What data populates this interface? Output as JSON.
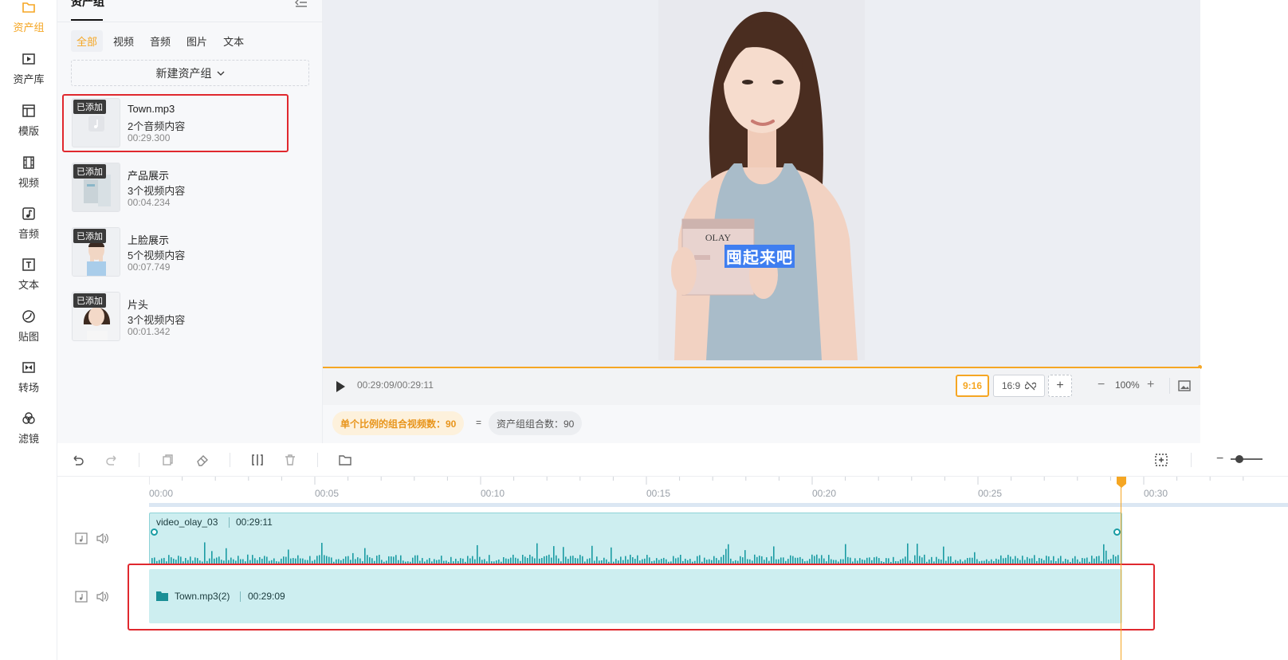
{
  "nav": {
    "items": [
      {
        "label": "资产组",
        "icon": "folder-icon",
        "active": true
      },
      {
        "label": "资产库",
        "icon": "play-square-icon"
      },
      {
        "label": "模版",
        "icon": "template-icon"
      },
      {
        "label": "视频",
        "icon": "film-icon"
      },
      {
        "label": "音频",
        "icon": "music-icon"
      },
      {
        "label": "文本",
        "icon": "text-icon"
      },
      {
        "label": "贴图",
        "icon": "sticker-icon"
      },
      {
        "label": "转场",
        "icon": "transition-icon"
      },
      {
        "label": "滤镜",
        "icon": "filter-icon"
      }
    ]
  },
  "panel": {
    "title": "资产组",
    "filters": [
      "全部",
      "视频",
      "音频",
      "图片",
      "文本"
    ],
    "new_group_label": "新建资产组",
    "assets": [
      {
        "badge": "已添加",
        "name": "Town.mp3",
        "count": "2个音频内容",
        "duration": "00:29.300"
      },
      {
        "badge": "已添加",
        "name": "产品展示",
        "count": "3个视频内容",
        "duration": "00:04.234"
      },
      {
        "badge": "已添加",
        "name": "上脸展示",
        "count": "5个视频内容",
        "duration": "00:07.749"
      },
      {
        "badge": "已添加",
        "name": "片头",
        "count": "3个视频内容",
        "duration": "00:01.342"
      }
    ]
  },
  "preview": {
    "subtitle": "囤起来吧",
    "product_brand": "OLAY",
    "progress": 1.0
  },
  "controls": {
    "timecode": "00:29:09/00:29:11",
    "ratio_active": "9:16",
    "ratio_other": "16:9",
    "add_label": "+",
    "zoom_minus": "−",
    "zoom": "100%",
    "zoom_plus": "+"
  },
  "stats": {
    "single_ratio_label": "单个比例的组合视频数：90",
    "equals": "=",
    "group_combo_label": "资产组组合数：90"
  },
  "timeline": {
    "ruler_ticks": [
      "00:00",
      "00:05",
      "00:10",
      "00:15",
      "00:20",
      "00:25",
      "00:30"
    ],
    "video_clip": {
      "name": "video_olay_03",
      "duration": "00:29:11"
    },
    "audio_clip": {
      "name": "Town.mp3(2)",
      "duration": "00:29:09"
    },
    "zoom_out": "−"
  },
  "colors": {
    "accent": "#f5a623",
    "highlight_box": "#e0282e",
    "clip_fill": "#cdeef0",
    "waveform": "#1a9ca3"
  }
}
